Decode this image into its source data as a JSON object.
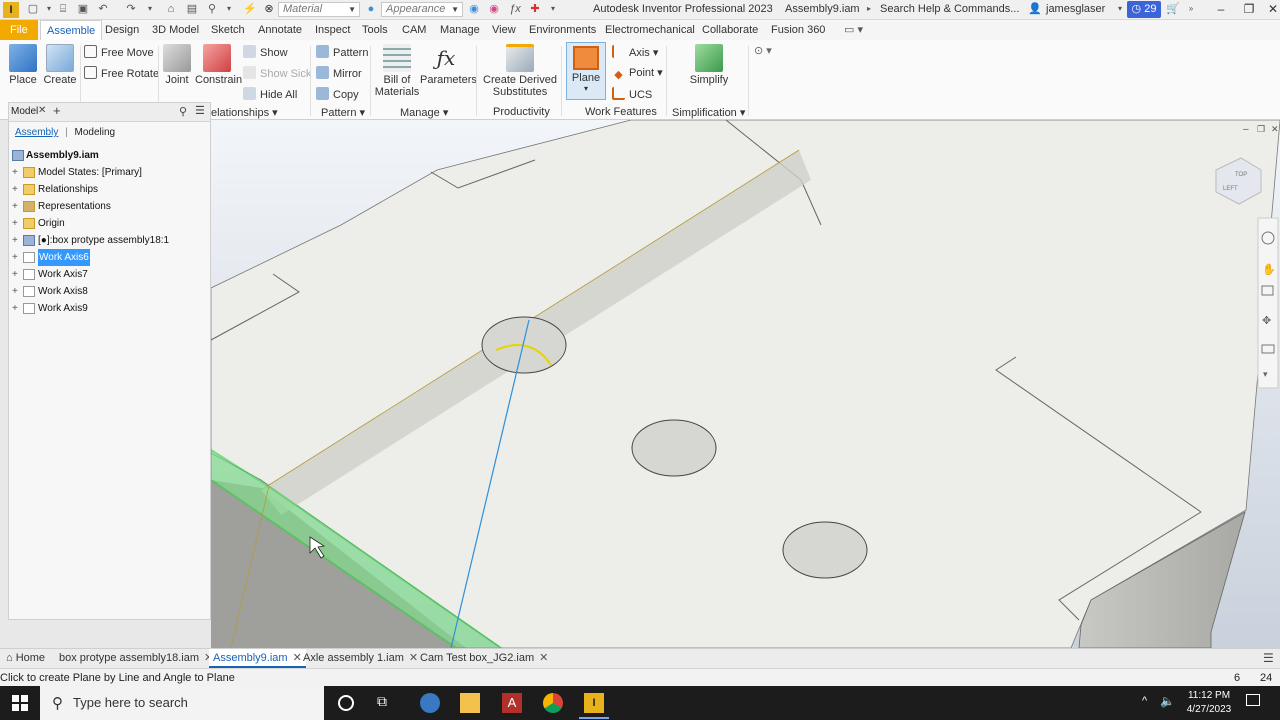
{
  "titlebar": {
    "logo": "I",
    "material_placeholder": "Material",
    "appearance_placeholder": "Appearance",
    "app_title": "Autodesk Inventor Professional 2023",
    "doc_title": "Assembly9.iam",
    "search_placeholder": "Search Help & Commands...",
    "user": "jamesglaser",
    "notification_count": "29"
  },
  "menu_tabs": [
    "File",
    "Assemble",
    "Design",
    "3D Model",
    "Sketch",
    "Annotate",
    "Inspect",
    "Tools",
    "CAM",
    "Manage",
    "View",
    "Environments",
    "Electromechanical",
    "Collaborate",
    "Fusion 360"
  ],
  "active_tab": "Assemble",
  "ribbon": {
    "place": "Place",
    "create": "Create",
    "free_move": "Free Move",
    "free_rotate": "Free Rotate",
    "joint": "Joint",
    "constrain": "Constrain",
    "show": "Show",
    "show_sick": "Show Sick",
    "hide_all": "Hide All",
    "pattern": "Pattern",
    "mirror": "Mirror",
    "copy": "Copy",
    "bill_line1": "Bill of",
    "bill_line2": "Materials",
    "parameters": "Parameters",
    "derived_line1": "Create Derived",
    "derived_line2": "Substitutes",
    "plane": "Plane",
    "axis": "Axis",
    "point": "Point",
    "ucs": "UCS",
    "simplify": "Simplify",
    "groups": {
      "relationships": "elationships",
      "pattern": "Pattern",
      "manage": "Manage",
      "productivity": "Productivity",
      "work_features": "Work Features",
      "simplification": "Simplification"
    }
  },
  "browser": {
    "tab": "Model",
    "subtab_assembly": "Assembly",
    "subtab_modeling": "Modeling",
    "root": "Assembly9.iam",
    "items": [
      {
        "label": "Model States: [Primary]"
      },
      {
        "label": "Relationships"
      },
      {
        "label": "Representations"
      },
      {
        "label": "Origin"
      },
      {
        "label": "[●]:box protype assembly18:1"
      },
      {
        "label": "Work Axis6"
      },
      {
        "label": "Work Axis7"
      },
      {
        "label": "Work Axis8"
      },
      {
        "label": "Work Axis9"
      }
    ]
  },
  "viewcube": {
    "face_top": "TOP",
    "face_left": "LEFT"
  },
  "doc_tabs": {
    "home": "Home",
    "tabs": [
      "box protype assembly18.iam",
      "Assembly9.iam",
      "Axle assembly 1.iam",
      "Cam Test box_JG2.iam"
    ],
    "active": "Assembly9.iam"
  },
  "status": {
    "message": "Click to create Plane by Line and Angle to Plane",
    "count_a": "6",
    "count_b": "24"
  },
  "taskbar": {
    "search_placeholder": "Type here to search",
    "time": "11:12 PM",
    "date": "4/27/2023"
  },
  "colors": {
    "file_tab": "#f2a900",
    "accent": "#1763b8",
    "selection_green": "#3cd24a",
    "work_axis": "#2f8fd9"
  }
}
